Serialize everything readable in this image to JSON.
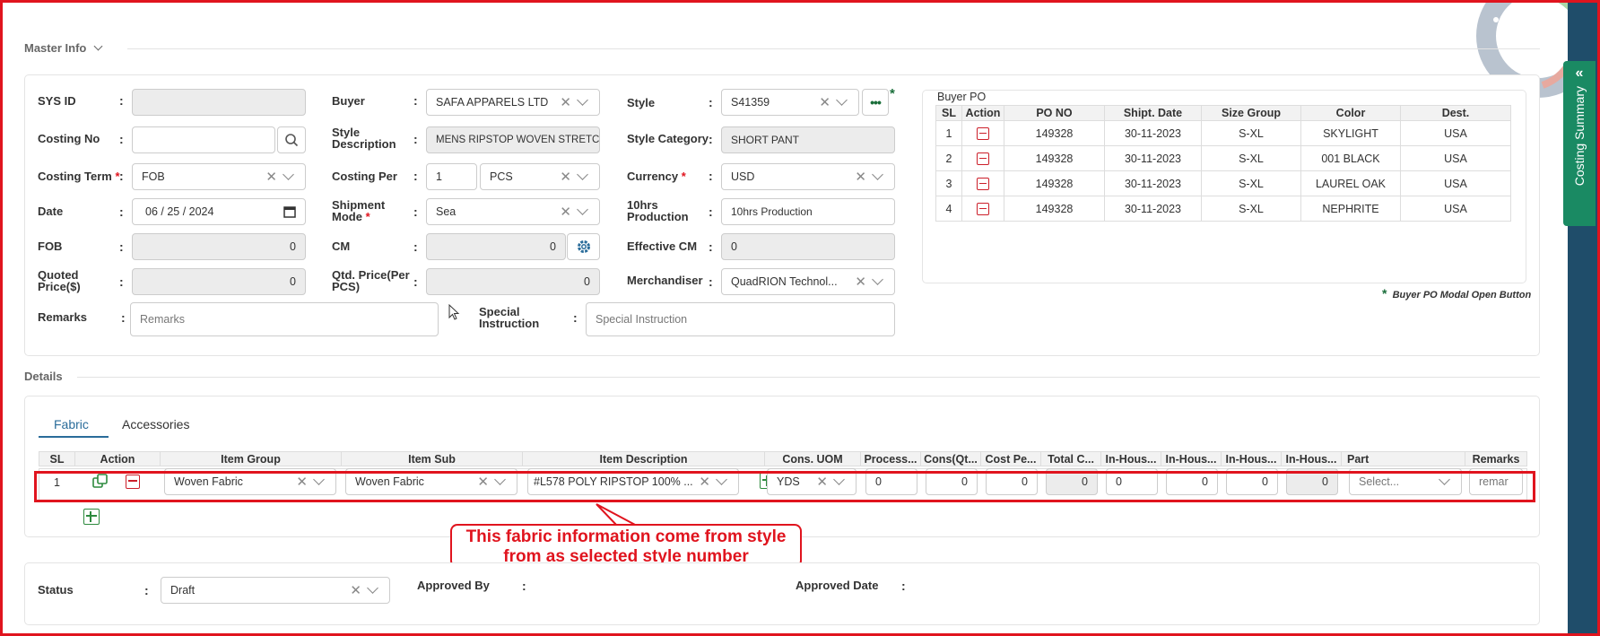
{
  "master": {
    "section_title": "Master Info",
    "sys_id_label": "SYS ID",
    "costing_no_label": "Costing No",
    "costing_term_label": "Costing Term",
    "costing_term_value": "FOB",
    "date_label": "Date",
    "date_value": "06 / 25 / 2024",
    "fob_label": "FOB",
    "fob_value": "0",
    "quoted_price_label": "Quoted Price($)",
    "quoted_price_value": "0",
    "remarks_label": "Remarks",
    "remarks_placeholder": "Remarks",
    "buyer_label": "Buyer",
    "buyer_value": "SAFA APPARELS LTD",
    "style_desc_label": "Style Description",
    "style_desc_value": "MENS RIPSTOP WOVEN STRETC",
    "costing_per_label": "Costing Per",
    "costing_per_qty": "1",
    "costing_per_unit": "PCS",
    "shipment_mode_label": "Shipment Mode",
    "shipment_mode_value": "Sea",
    "cm_label": "CM",
    "cm_value": "0",
    "qtd_price_label": "Qtd. Price(Per PCS)",
    "qtd_price_value": "0",
    "special_instruction_label": "Special Instruction",
    "special_instruction_placeholder": "Special Instruction",
    "style_label": "Style",
    "style_value": "S41359",
    "style_category_label": "Style Category",
    "style_category_value": "SHORT PANT",
    "currency_label": "Currency",
    "currency_value": "USD",
    "production_label": "10hrs Production",
    "production_value": "10hrs Production",
    "effective_cm_label": "Effective CM",
    "effective_cm_value": "0",
    "merchandiser_label": "Merchandiser",
    "merchandiser_value": "QuadRION Technol...",
    "required_mark": "*",
    "colon": ":"
  },
  "buyer_po": {
    "title": "Buyer PO",
    "headers": [
      "SL",
      "Action",
      "PO NO",
      "Shipt. Date",
      "Size Group",
      "Color",
      "Dest."
    ],
    "rows": [
      {
        "sl": "1",
        "po": "149328",
        "date": "30-11-2023",
        "size": "S-XL",
        "color": "SKYLIGHT",
        "dest": "USA"
      },
      {
        "sl": "2",
        "po": "149328",
        "date": "30-11-2023",
        "size": "S-XL",
        "color": "001 BLACK",
        "dest": "USA"
      },
      {
        "sl": "3",
        "po": "149328",
        "date": "30-11-2023",
        "size": "S-XL",
        "color": "LAUREL OAK",
        "dest": "USA"
      },
      {
        "sl": "4",
        "po": "149328",
        "date": "30-11-2023",
        "size": "S-XL",
        "color": "NEPHRITE",
        "dest": "USA"
      }
    ],
    "note": "Buyer PO Modal Open Button"
  },
  "details": {
    "section_title": "Details",
    "tabs": [
      "Fabric",
      "Accessories"
    ],
    "headers": [
      "SL",
      "Action",
      "Item Group",
      "Item Sub",
      "Item Description",
      "Cons. UOM",
      "Process...",
      "Cons(Qt...",
      "Cost Pe...",
      "Total C...",
      "In-Hous...",
      "In-Hous...",
      "In-Hous...",
      "In-Hous...",
      "Part",
      "Remarks"
    ],
    "row": {
      "sl": "1",
      "item_group": "Woven Fabric",
      "item_sub": "Woven Fabric",
      "item_desc": "#L578 POLY RIPSTOP 100% ...",
      "uom": "YDS",
      "process": "0",
      "cons": "0",
      "cost": "0",
      "total": "0",
      "inhouse1": "0",
      "inhouse2": "0",
      "inhouse3": "0",
      "inhouse4": "0",
      "part_placeholder": "Select...",
      "remarks_placeholder": "remar"
    }
  },
  "callout": {
    "line1": "This fabric information come from style",
    "line2": "from as selected style number"
  },
  "status": {
    "status_label": "Status",
    "status_value": "Draft",
    "approved_by_label": "Approved By",
    "approved_date_label": "Approved Date"
  },
  "sidebar": {
    "costing_summary": "Costing Summary"
  },
  "colors": {
    "accent_red": "#e0141e",
    "teal": "#1a8a63",
    "navy": "#1f4d6a",
    "tab_blue": "#2a6c9a"
  }
}
